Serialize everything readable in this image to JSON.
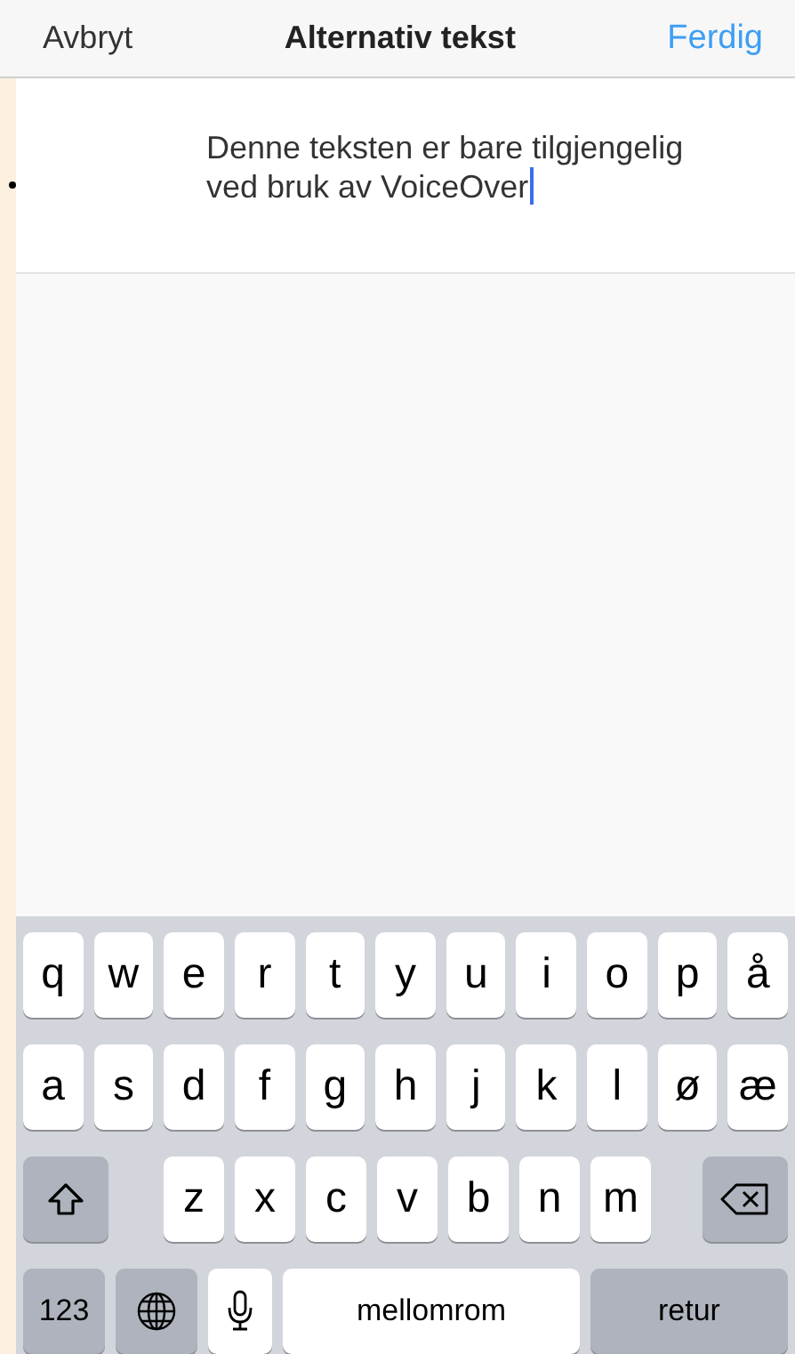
{
  "nav_bar": {
    "cancel": "Avbryt",
    "title": "Alternativ tekst",
    "done": "Ferdig"
  },
  "text_field": {
    "value": "Denne teksten er bare tilgjengelig ved bruk av VoiceOver"
  },
  "keyboard": {
    "top_row": [
      {
        "kind": "letter",
        "label": "q"
      },
      {
        "kind": "letter",
        "label": "w"
      },
      {
        "kind": "letter",
        "label": "e"
      },
      {
        "kind": "letter",
        "label": "r"
      },
      {
        "kind": "letter",
        "label": "t"
      },
      {
        "kind": "letter",
        "label": "y"
      },
      {
        "kind": "letter",
        "label": "u"
      },
      {
        "kind": "letter",
        "label": "i"
      },
      {
        "kind": "letter",
        "label": "o"
      },
      {
        "kind": "letter",
        "label": "p"
      },
      {
        "kind": "letter",
        "label": "å"
      }
    ],
    "middle_row": [
      {
        "kind": "letter",
        "label": "a"
      },
      {
        "kind": "letter",
        "label": "s"
      },
      {
        "kind": "letter",
        "label": "d"
      },
      {
        "kind": "letter",
        "label": "f"
      },
      {
        "kind": "letter",
        "label": "g"
      },
      {
        "kind": "letter",
        "label": "h"
      },
      {
        "kind": "letter",
        "label": "j"
      },
      {
        "kind": "letter",
        "label": "k"
      },
      {
        "kind": "letter",
        "label": "l"
      },
      {
        "kind": "letter",
        "label": "ø"
      },
      {
        "kind": "letter",
        "label": "æ"
      }
    ],
    "lower_row": [
      {
        "kind": "shift"
      },
      {
        "kind": "letter",
        "label": "z"
      },
      {
        "kind": "letter",
        "label": "x"
      },
      {
        "kind": "letter",
        "label": "c"
      },
      {
        "kind": "letter",
        "label": "v"
      },
      {
        "kind": "letter",
        "label": "b"
      },
      {
        "kind": "letter",
        "label": "n"
      },
      {
        "kind": "letter",
        "label": "m"
      },
      {
        "kind": "backspace"
      }
    ],
    "bottom_row": [
      {
        "kind": "numbers",
        "label": "123"
      },
      {
        "kind": "globe"
      },
      {
        "kind": "mic"
      },
      {
        "kind": "space",
        "label": "mellomrom"
      },
      {
        "kind": "return",
        "label": "retur"
      }
    ]
  }
}
